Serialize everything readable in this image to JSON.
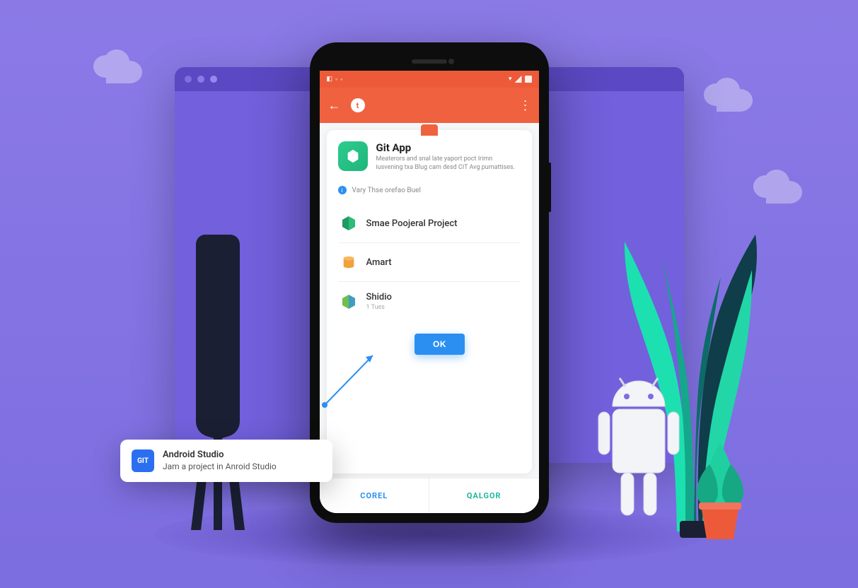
{
  "statusbar": {
    "time_icons": "▾ ◦ ◦",
    "net_icons": "▾ ◧ ◨"
  },
  "appbar": {
    "title_icon": "t"
  },
  "card": {
    "app_title": "Git App",
    "app_desc": "Meaterors and snal late yaport poct Irimn iusvening txa Blug cam desd CIT Avg pumattises.",
    "info_label": "Vary Thse orefao Buel"
  },
  "projects": [
    {
      "title": "Smae Poojeral Project",
      "sub": "",
      "color": "#2bbd7a",
      "shape": "cube"
    },
    {
      "title": "Amart",
      "sub": "",
      "color": "#f2a23c",
      "shape": "cyl"
    },
    {
      "title": "Shidio",
      "sub": "1 Tues",
      "color": "#5ab04e",
      "shape": "cube2"
    }
  ],
  "ok_button": "OK",
  "bottom_actions": {
    "left": "COREL",
    "right": "QALGOR"
  },
  "callout": {
    "icon_label": "GIT",
    "title": "Android Studio",
    "subtitle": "Jam a project in Anroid Studio"
  }
}
